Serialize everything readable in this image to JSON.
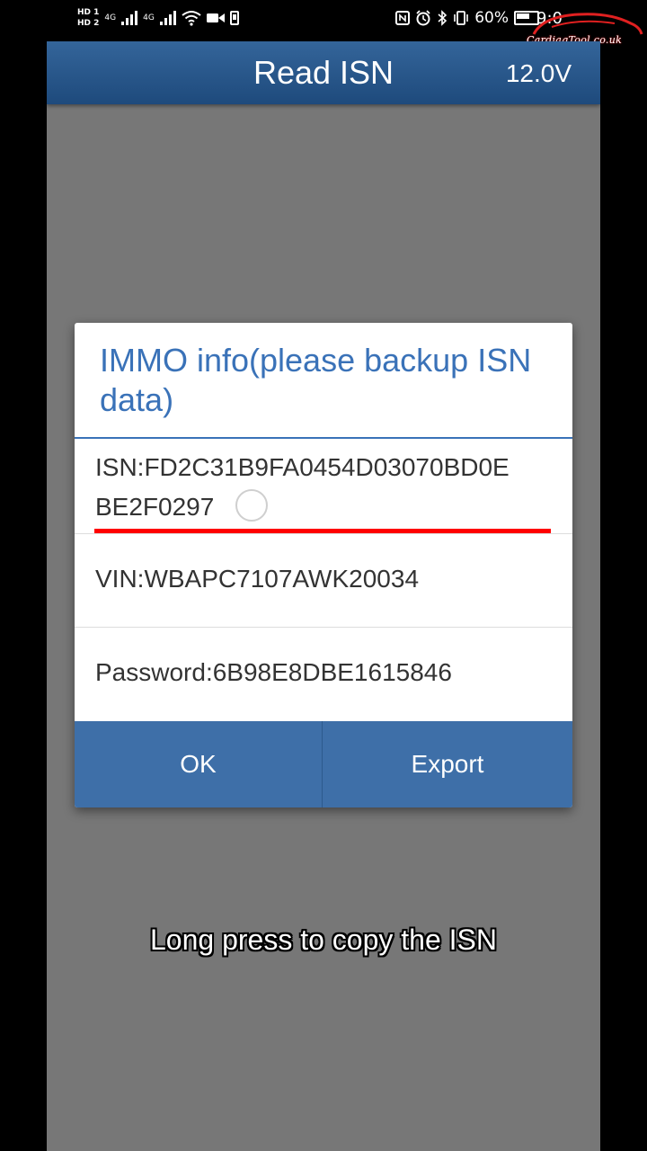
{
  "status_bar": {
    "hd_top": "HD 1",
    "hd_bottom": "HD 2",
    "network_1": "4G",
    "network_2": "4G",
    "battery_percent": "60%",
    "time": "9:0"
  },
  "watermark": {
    "text": "CardiagTool.co.uk"
  },
  "app_bar": {
    "title": "Read ISN",
    "voltage": "12.0V"
  },
  "dialog": {
    "title": "IMMO info(please backup ISN data)",
    "rows": [
      {
        "line1": "ISN:FD2C31B9FA0454D03070BD0E",
        "line2": "BE2F0297"
      },
      {
        "text": "VIN:WBAPC7107AWK20034"
      },
      {
        "text": "Password:6B98E8DBE1615846"
      }
    ],
    "ok_label": "OK",
    "export_label": "Export"
  },
  "caption": "Long press to copy the ISN",
  "colors": {
    "app_bar": "#2a5a8e",
    "dialog_title": "#3a72b8",
    "buttons": "#3e6fa8",
    "highlight": "#ff0000",
    "background_dim": "#777777"
  }
}
